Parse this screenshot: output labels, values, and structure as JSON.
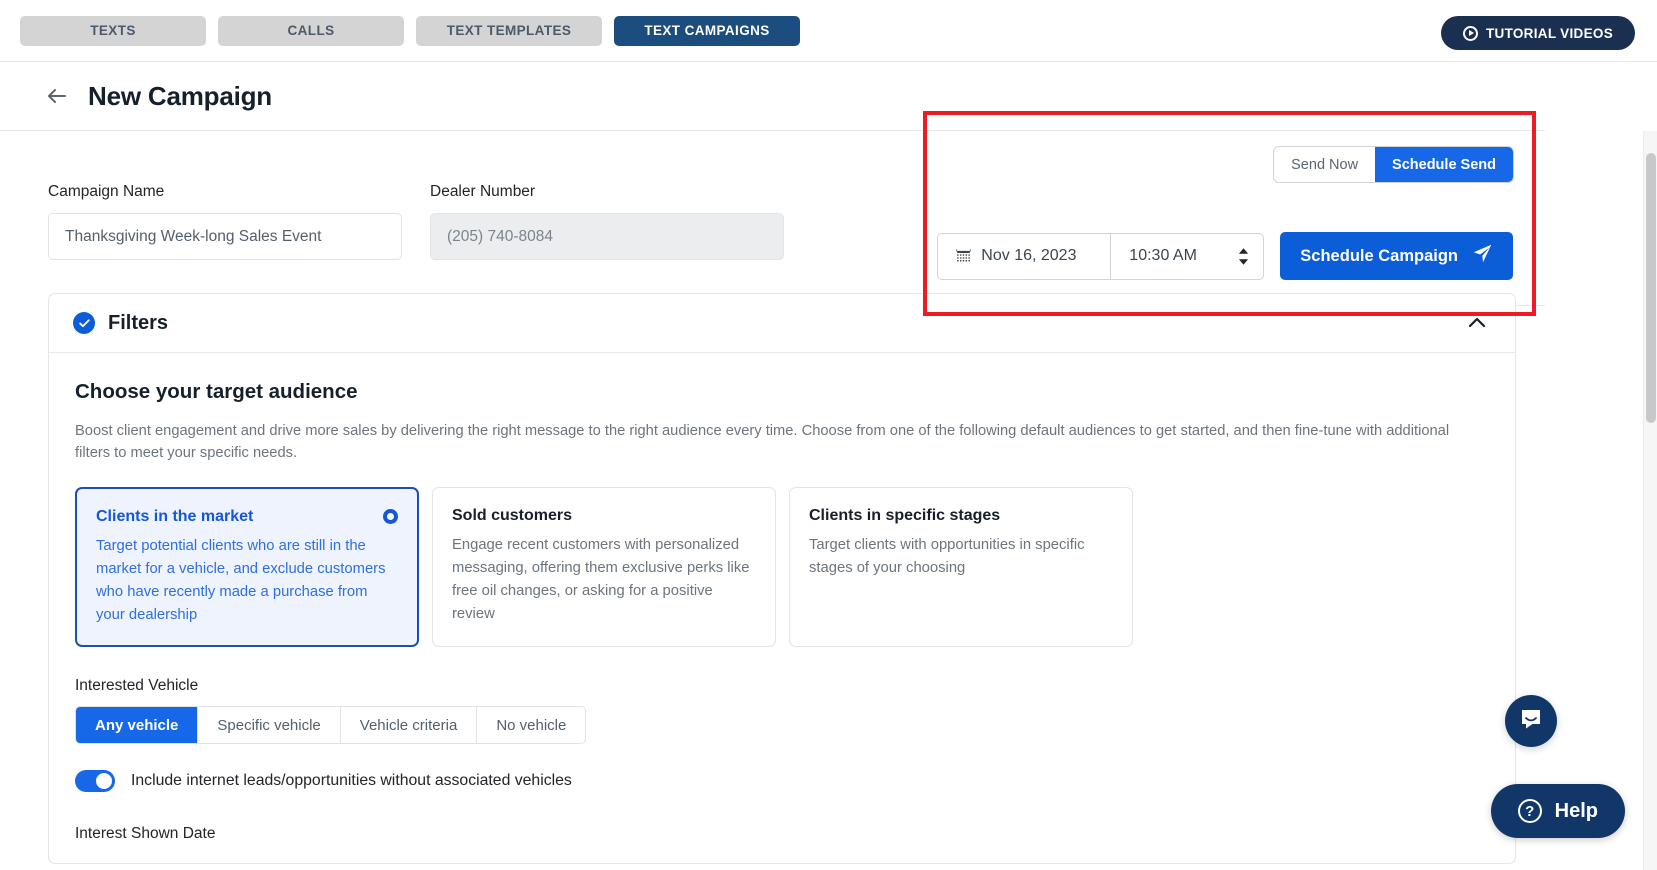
{
  "topbar": {
    "tabs": [
      {
        "label": "TEXTS",
        "active": false
      },
      {
        "label": "CALLS",
        "active": false
      },
      {
        "label": "TEXT TEMPLATES",
        "active": false
      },
      {
        "label": "TEXT CAMPAIGNS",
        "active": true
      }
    ],
    "tutorial_button": "TUTORIAL VIDEOS"
  },
  "header": {
    "title": "New Campaign",
    "back_icon": "arrow-left-icon"
  },
  "schedule": {
    "send_now_label": "Send Now",
    "schedule_send_label": "Schedule Send",
    "date_value": "Nov 16, 2023",
    "time_value": "10:30 AM",
    "schedule_campaign_label": "Schedule Campaign",
    "calendar_icon": "calendar-icon",
    "send_icon": "paper-plane-icon",
    "stepper_icon": "up-down-stepper-icon"
  },
  "form": {
    "campaign_name_label": "Campaign Name",
    "campaign_name_value": "Thanksgiving Week-long Sales Event",
    "dealer_number_label": "Dealer Number",
    "dealer_number_value": "(205) 740-8084"
  },
  "filters": {
    "title": "Filters",
    "collapse_icon": "chevron-up-icon",
    "check_icon": "check-icon",
    "section_title": "Choose your target audience",
    "section_desc": "Boost client engagement and drive more sales by delivering the right message to the right audience every time. Choose from one of the following default audiences to get started, and then fine-tune with additional filters to meet your specific needs.",
    "audiences": [
      {
        "title": "Clients in the market",
        "desc": "Target potential clients who are still in the market for a vehicle, and exclude customers who have recently made a purchase from your dealership",
        "selected": true
      },
      {
        "title": "Sold customers",
        "desc": "Engage recent customers with personalized messaging, offering them exclusive perks like free oil changes, or asking for a positive review",
        "selected": false
      },
      {
        "title": "Clients in specific stages",
        "desc": "Target clients with opportunities in specific stages of your choosing",
        "selected": false
      }
    ],
    "interested_vehicle_label": "Interested Vehicle",
    "vehicle_options": [
      {
        "label": "Any vehicle",
        "active": true
      },
      {
        "label": "Specific vehicle",
        "active": false
      },
      {
        "label": "Vehicle criteria",
        "active": false
      },
      {
        "label": "No vehicle",
        "active": false
      }
    ],
    "include_toggle_label": "Include internet leads/opportunities without associated vehicles",
    "include_toggle_on": true,
    "interest_shown_date_label": "Interest Shown Date"
  },
  "widgets": {
    "chat_icon": "chat-bubble-icon",
    "help_label": "Help",
    "help_icon": "question-circle-icon"
  },
  "colors": {
    "brand_navy": "#1b4d7e",
    "accent_blue": "#1768e8",
    "primary_blue": "#0b5ed7",
    "annotation_red": "#ed1c24",
    "dark_navy": "#103768"
  }
}
